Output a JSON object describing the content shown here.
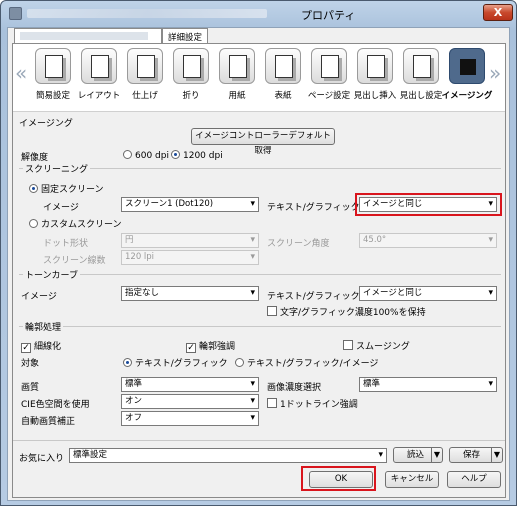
{
  "window": {
    "title": "プロパティ",
    "close_label": "X"
  },
  "tabs": {
    "detail": "詳細設定"
  },
  "iconbar": {
    "prev": "«",
    "next": "»",
    "items": [
      "簡易設定",
      "レイアウト",
      "仕上げ",
      "折り",
      "用紙",
      "表紙",
      "ページ設定",
      "見出し挿入",
      "見出し設定",
      "イメージング"
    ]
  },
  "imaging": {
    "title": "イメージング",
    "default_button": "イメージコントローラーデフォルト取得",
    "resolution_label": "解像度",
    "dpi600": "600 dpi",
    "dpi1200": "1200 dpi"
  },
  "screening": {
    "title": "スクリーニング",
    "fixed_label": "固定スクリーン",
    "image_label": "イメージ",
    "image_value": "スクリーン1 (Dot120)",
    "text_graphic_label": "テキスト/グラフィック",
    "text_graphic_value": "イメージと同じ",
    "custom_label": "カスタムスクリーン",
    "dot_shape_label": "ドット形状",
    "dot_shape_value": "円",
    "angle_label": "スクリーン角度",
    "angle_value": "45.0°",
    "lines_label": "スクリーン線数",
    "lines_value": "120 lpi"
  },
  "tone": {
    "title": "トーンカーブ",
    "image_label": "イメージ",
    "image_value": "指定なし",
    "tg_label": "テキスト/グラフィック",
    "tg_value": "イメージと同じ",
    "keep_label": "文字/グラフィック濃度100%を保持"
  },
  "outline": {
    "title": "輪郭処理",
    "thin_label": "細線化",
    "enhance_label": "輪郭強調",
    "smoothing_label": "スムージング",
    "target_label": "対象",
    "target_tg": "テキスト/グラフィック",
    "target_tgi": "テキスト/グラフィック/イメージ"
  },
  "quality": {
    "label": "画質",
    "value": "標準",
    "density_label": "画像濃度選択",
    "density_value": "標準",
    "cie_label": "CIE色空間を使用",
    "cie_value": "オン",
    "dot_line_label": "1ドットライン強調",
    "auto_label": "自動画質補正",
    "auto_value": "オフ"
  },
  "favorites": {
    "label": "お気に入り",
    "value": "標準設定",
    "load": "読込",
    "save": "保存"
  },
  "buttons": {
    "ok": "OK",
    "cancel": "キャンセル",
    "help": "ヘルプ"
  }
}
